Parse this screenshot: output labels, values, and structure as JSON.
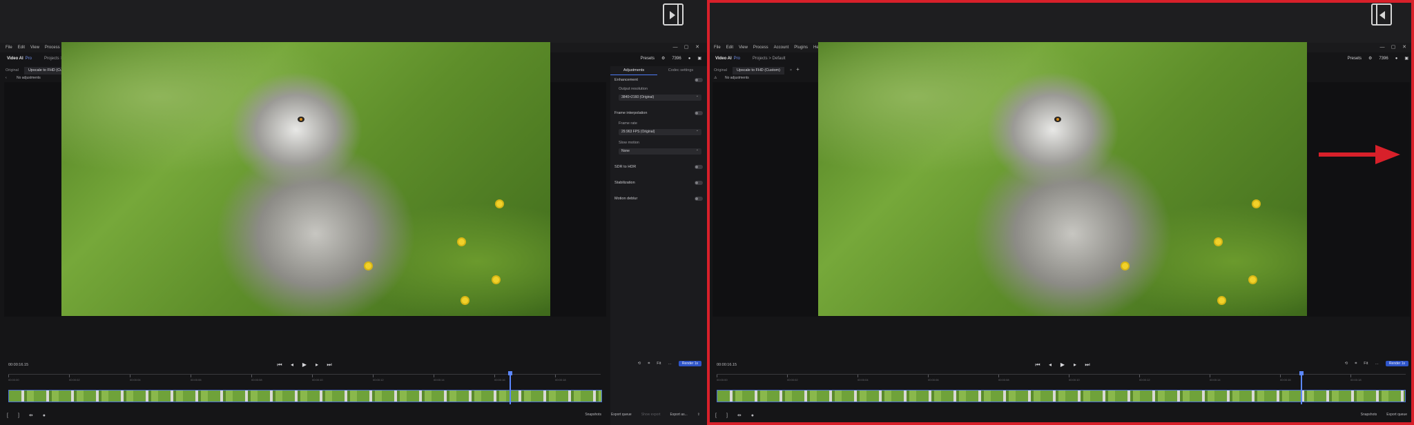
{
  "top_icons": {
    "left": "panel-expand-icon",
    "right": "panel-collapse-icon"
  },
  "app": {
    "menu": [
      "File",
      "Edit",
      "View",
      "Process",
      "Account",
      "Plugins",
      "Help"
    ],
    "brand": "Video AI",
    "brand_tier": "Pro",
    "breadcrumb_projects": "Projects",
    "breadcrumb_sep": ">",
    "breadcrumb_current": "Default",
    "presets": "Presets",
    "credits": "7396",
    "tab_original": "Original",
    "tab_active": "Upscale to FHD (Custom)",
    "no_adjustments": "No adjustments",
    "timecode": "00:00:16.15",
    "fit": "Fit",
    "render_badge": "Render 1s",
    "snapshots": "Snapshots",
    "export_queue": "Export queue",
    "show_export": "Show export",
    "export_as": "Export as..."
  },
  "panel": {
    "tab_adjustments": "Adjustments",
    "tab_codec": "Codec settings",
    "enhancement": "Enhancement",
    "output_resolution_label": "Output resolution",
    "output_resolution_value": "3840×2160 (Original)",
    "frame_interpolation": "Frame interpolation",
    "frame_rate_label": "Frame rate",
    "frame_rate_value": "29.963 FPS (Original)",
    "slow_motion_label": "Slow motion",
    "slow_motion_value": "None",
    "sdr_to_hdr": "SDR to HDR",
    "stabilization": "Stabilization",
    "motion_deblur": "Motion deblur"
  },
  "ruler_labels": [
    "00:00:00",
    "00:00:02",
    "00:00:04",
    "00:00:06",
    "00:00:08",
    "00:00:10",
    "00:00:12",
    "00:00:14",
    "00:00:16",
    "00:00:18"
  ],
  "accent_colors": {
    "highlight": "#d8202a",
    "selection": "#5b87ff"
  }
}
